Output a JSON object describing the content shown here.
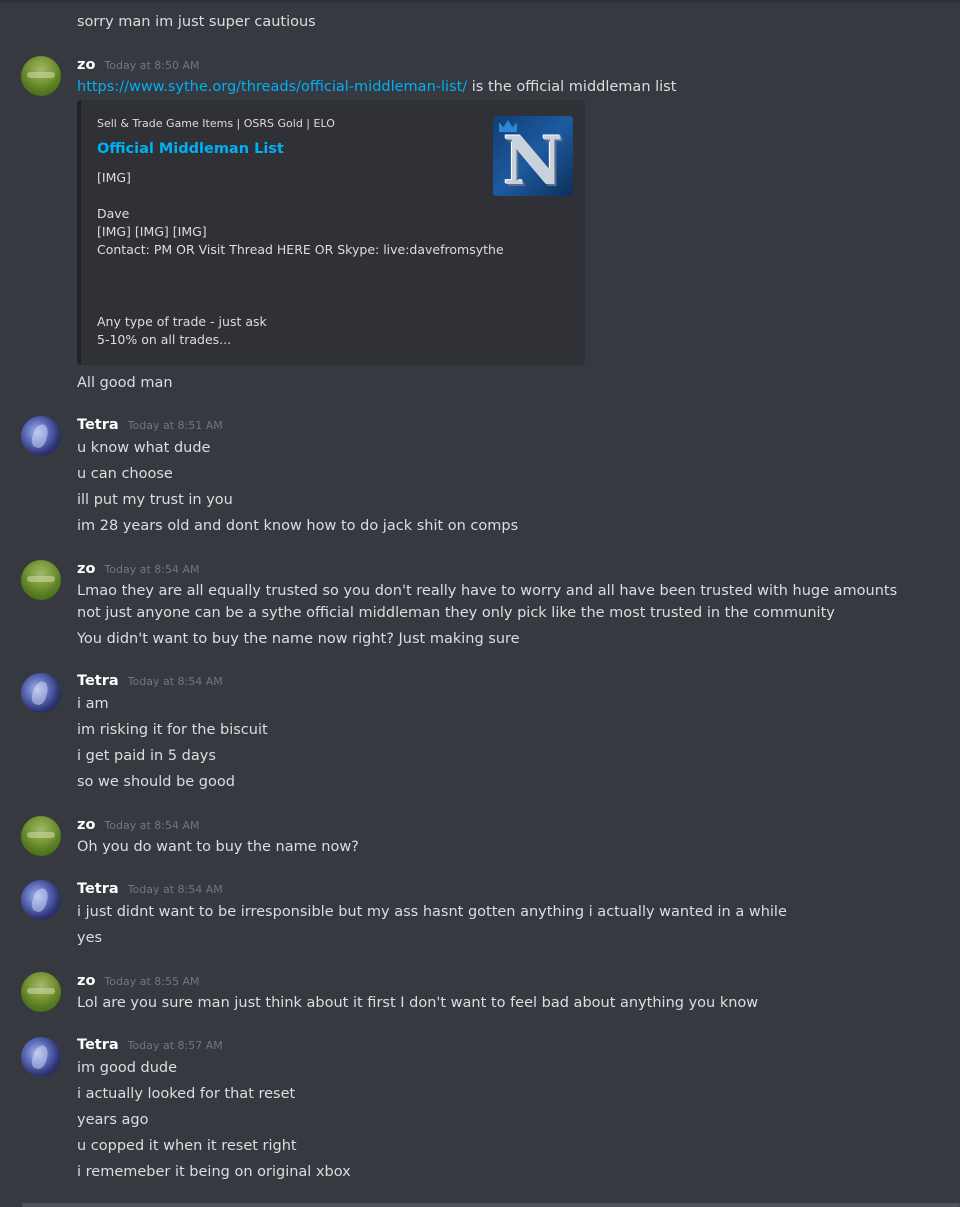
{
  "colors": {
    "background": "#36393f",
    "text": "#dcddde",
    "link": "#00b0f4",
    "timestamp": "#72767d",
    "embed_bg": "#2f3136"
  },
  "messages": [
    {
      "lines": [
        "sorry man im just super cautious"
      ]
    },
    {
      "author": "zo",
      "timestamp": "Today at 8:50 AM",
      "link_text": "https://www.sythe.org/threads/official-middleman-list/",
      "link_suffix": " is the official middleman list",
      "embed": {
        "provider": "Sell & Trade Game Items | OSRS Gold | ELO",
        "title": "Official Middleman List",
        "description": "[IMG]\n\nDave\n[IMG] [IMG] [IMG]\nContact: PM OR Visit Thread HERE OR Skype: live:davefromsythe\n\n\n\nAny type of trade - just ask\n5-10% on all trades...",
        "thumbnail_icon": "sythe-logo-icon",
        "thumbnail_letter": "N"
      },
      "lines": [
        "All good man"
      ]
    },
    {
      "author": "Tetra",
      "timestamp": "Today at 8:51 AM",
      "lines": [
        "u know what dude",
        "u can choose",
        "ill put my trust in you",
        "im 28 years old and dont know how to do jack shit on comps"
      ]
    },
    {
      "author": "zo",
      "timestamp": "Today at 8:54 AM",
      "lines": [
        "Lmao they are all equally trusted so you don't really have to worry and all have been trusted with huge amounts not just anyone can be a sythe official middleman they only pick like the most trusted in the community",
        "You didn't want to buy the name now right? Just making sure"
      ]
    },
    {
      "author": "Tetra",
      "timestamp": "Today at 8:54 AM",
      "lines": [
        "i am",
        "im risking it for the biscuit",
        "i get paid in 5 days",
        "so we should be good"
      ]
    },
    {
      "author": "zo",
      "timestamp": "Today at 8:54 AM",
      "lines": [
        "Oh you do want to buy the name now?"
      ]
    },
    {
      "author": "Tetra",
      "timestamp": "Today at 8:54 AM",
      "lines": [
        "i just didnt want to be irresponsible but my ass hasnt gotten anything i actually wanted in a while",
        "yes"
      ]
    },
    {
      "author": "zo",
      "timestamp": "Today at 8:55 AM",
      "lines": [
        "Lol are you sure man just think about it first I don't want to feel bad about anything you know"
      ]
    },
    {
      "author": "Tetra",
      "timestamp": "Today at 8:57 AM",
      "lines": [
        "im good dude",
        "i actually looked for that reset",
        "years ago",
        "u copped it when it reset right",
        "i rememeber it being on original xbox"
      ]
    }
  ]
}
